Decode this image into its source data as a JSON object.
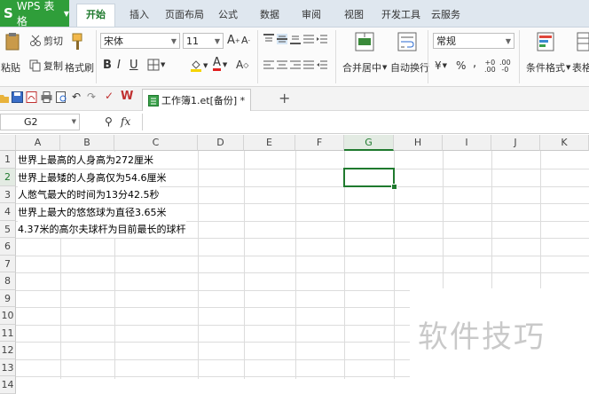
{
  "app": {
    "logo_letter": "S",
    "title": "WPS 表格",
    "dropdown": "▼"
  },
  "menu_tabs": [
    "开始",
    "插入",
    "页面布局",
    "公式",
    "数据",
    "审阅",
    "视图",
    "开发工具",
    "云服务"
  ],
  "ribbon": {
    "paste": "粘贴",
    "cut": "剪切",
    "copy": "复制",
    "format_painter": "格式刷",
    "font_name": "宋体",
    "font_size": "11",
    "merge_center": "合并居中",
    "wrap_text": "自动换行",
    "number_format": "常规",
    "conditional_format": "条件格式",
    "table_style": "表格"
  },
  "document": {
    "tab_label": "工作簿1.et[备份] *",
    "add_tab": "+"
  },
  "formula": {
    "name_box": "G2",
    "fx": "fx"
  },
  "columns": [
    "A",
    "B",
    "C",
    "D",
    "E",
    "F",
    "G",
    "H",
    "I",
    "J",
    "K"
  ],
  "rows": [
    "1",
    "2",
    "3",
    "4",
    "5",
    "6",
    "7",
    "8",
    "9",
    "10",
    "11",
    "12",
    "13",
    "14"
  ],
  "cells": [
    "世界上最高的人身高为272厘米",
    "世界上最矮的人身高仅为54.6厘米",
    "人憋气最大的时间为13分42.5秒",
    "世界上最大的悠悠球为直径3.65米",
    "4.37米的高尔夫球杆为目前最长的球杆"
  ],
  "selected_cell": "G2",
  "watermark": "软件技巧",
  "colors": {
    "accent": "#2f9e3a",
    "selection": "#1f7a2e"
  }
}
